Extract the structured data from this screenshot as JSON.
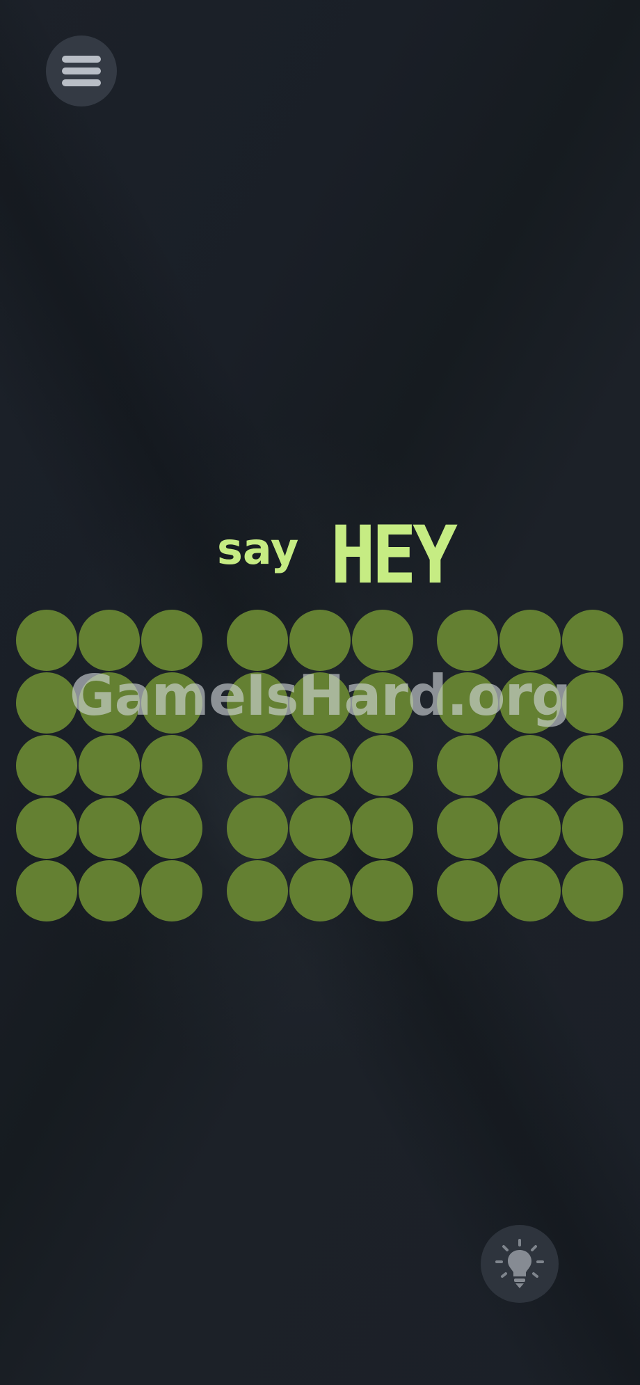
{
  "header": {
    "menu_icon": "hamburger-menu-icon"
  },
  "level": {
    "prompt_small": "say",
    "prompt_word": "HEY"
  },
  "board": {
    "panels": 3,
    "rows": 5,
    "cols_per_panel": 3,
    "dot_color": "#648032",
    "text_color": "#c6ec83"
  },
  "watermark": "GameIsHard.org",
  "footer": {
    "hint_icon": "lightbulb-icon"
  }
}
